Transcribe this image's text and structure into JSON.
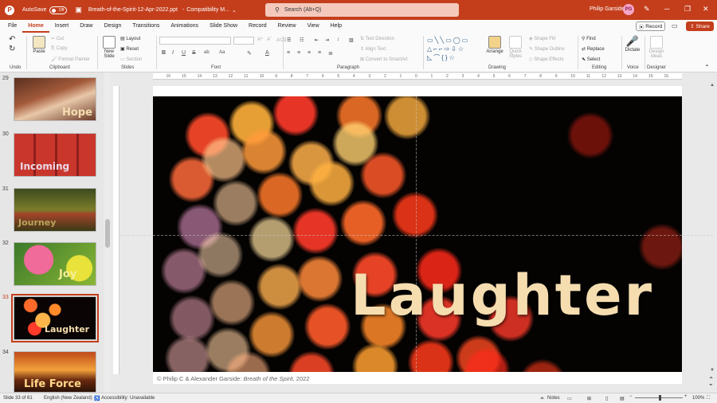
{
  "titlebar": {
    "app_icon": "P",
    "autosave_label": "AutoSave",
    "autosave_state": "Off",
    "file_name": "Breath-of-the-Spirit-12-Apr-2022.ppt",
    "mode": "Compatibility M...",
    "search_placeholder": "Search (Alt+Q)",
    "user_name": "Philip Garside",
    "user_initials": "PG",
    "brand_color": "#c43e1c"
  },
  "menu": {
    "tabs": [
      "File",
      "Home",
      "Insert",
      "Draw",
      "Design",
      "Transitions",
      "Animations",
      "Slide Show",
      "Record",
      "Review",
      "View",
      "Help"
    ],
    "active": "Home",
    "record_label": "Record",
    "share_label": "Share"
  },
  "ribbon": {
    "undo_label": "Undo",
    "clipboard": {
      "paste": "Paste",
      "cut": "Cut",
      "copy": "Copy",
      "format_painter": "Format Painter",
      "label": "Clipboard"
    },
    "slides": {
      "new_slide_1": "New",
      "new_slide_2": "Slide",
      "layout": "Layout",
      "reset": "Reset",
      "section": "Section",
      "label": "Slides"
    },
    "font": {
      "label": "Font"
    },
    "paragraph": {
      "text_direction": "Text Direction",
      "align_text": "Align Text",
      "convert_smartart": "Convert to SmartArt",
      "label": "Paragraph"
    },
    "drawing": {
      "arrange": "Arrange",
      "quick_styles_1": "Quick",
      "quick_styles_2": "Styles",
      "shape_fill": "Shape Fill",
      "shape_outline": "Shape Outline",
      "shape_effects": "Shape Effects",
      "label": "Drawing"
    },
    "editing": {
      "find": "Find",
      "replace": "Replace",
      "select": "Select",
      "label": "Editing"
    },
    "voice": {
      "dictate": "Dictate",
      "label": "Voice"
    },
    "designer": {
      "design_ideas_1": "Design",
      "design_ideas_2": "Ideas",
      "label": "Designer"
    }
  },
  "slides_panel": {
    "thumbs": [
      {
        "num": "29",
        "label": "Hope"
      },
      {
        "num": "30",
        "label": "Incoming"
      },
      {
        "num": "31",
        "label": "Journey"
      },
      {
        "num": "32",
        "label": "Joy"
      },
      {
        "num": "33",
        "label": "Laughter"
      },
      {
        "num": "34",
        "label": "Life Force"
      }
    ],
    "active_index": 4
  },
  "ruler_ticks": [
    "16",
    "15",
    "14",
    "13",
    "12",
    "11",
    "10",
    "9",
    "8",
    "7",
    "6",
    "5",
    "4",
    "3",
    "2",
    "1",
    "0",
    "1",
    "2",
    "3",
    "4",
    "5",
    "6",
    "7",
    "8",
    "9",
    "10",
    "11",
    "12",
    "13",
    "14",
    "15",
    "16"
  ],
  "slide": {
    "title": "Laughter",
    "credit_prefix": "© Philip C & Alexander Garside: ",
    "credit_title": "Breath of the Spirit",
    "credit_suffix": ", 2022"
  },
  "statusbar": {
    "slide_info": "Slide 33 of 61",
    "language": "English (New Zealand)",
    "accessibility": "Accessibility: Unavailable",
    "notes": "Notes",
    "zoom": "100%"
  }
}
